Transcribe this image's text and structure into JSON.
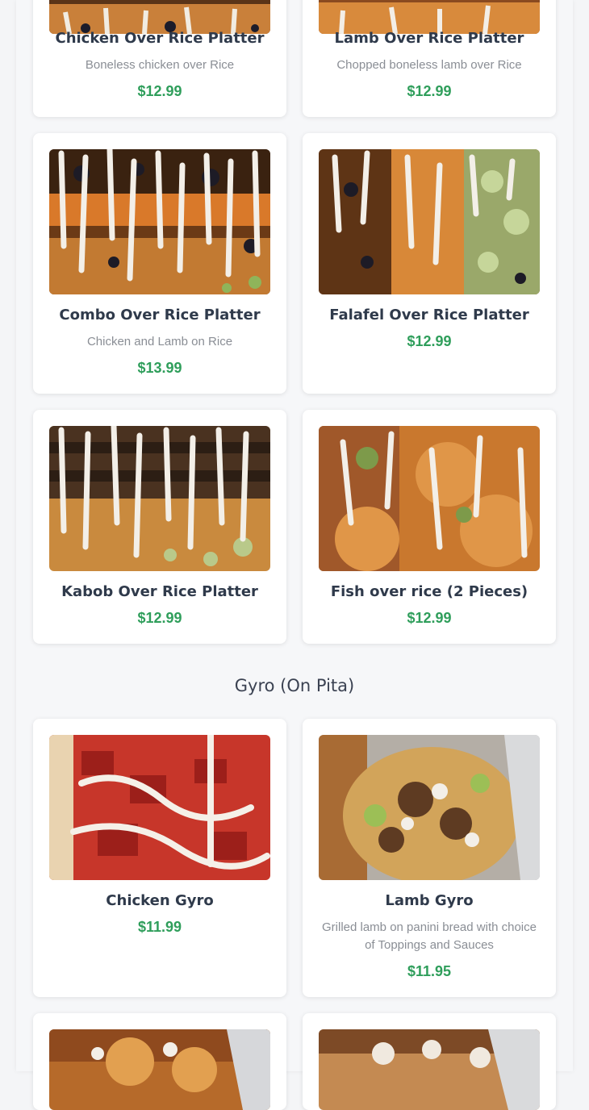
{
  "sections": [
    {
      "items": [
        {
          "title": "Chicken Over Rice Platter",
          "description": "Boneless chicken over Rice",
          "price": "$12.99",
          "image": "rice-platter-photo"
        },
        {
          "title": "Lamb Over Rice Platter",
          "description": "Chopped boneless lamb over Rice",
          "price": "$12.99",
          "image": "rice-platter-photo"
        },
        {
          "title": "Combo Over Rice Platter",
          "description": "Chicken and Lamb on Rice",
          "price": "$13.99",
          "image": "rice-platter-photo"
        },
        {
          "title": "Falafel Over Rice Platter",
          "description": "",
          "price": "$12.99",
          "image": "rice-platter-photo"
        },
        {
          "title": "Kabob Over Rice Platter",
          "description": "",
          "price": "$12.99",
          "image": "rice-platter-photo"
        },
        {
          "title": "Fish over rice (2 Pieces)",
          "description": "",
          "price": "$12.99",
          "image": "rice-platter-photo"
        }
      ]
    },
    {
      "title": "Gyro (On Pita)",
      "items": [
        {
          "title": "Chicken Gyro",
          "description": "",
          "price": "$11.99",
          "image": "gyro-photo"
        },
        {
          "title": "Lamb Gyro",
          "description": "Grilled lamb on panini bread with choice of Toppings and Sauces",
          "price": "$11.95",
          "image": "gyro-photo"
        },
        {
          "title": "",
          "description": "",
          "price": "",
          "image": "gyro-photo"
        },
        {
          "title": "",
          "description": "",
          "price": "",
          "image": "gyro-photo"
        }
      ]
    }
  ],
  "colors": {
    "price": "#2f9e5b",
    "title": "#2f3a4b",
    "description": "#8a8e95"
  }
}
